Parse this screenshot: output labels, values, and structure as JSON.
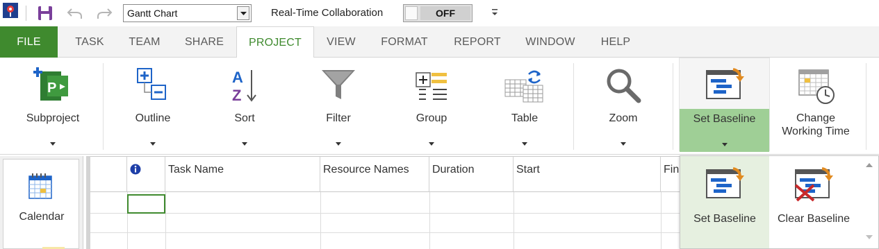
{
  "qat": {
    "view_select_value": "Gantt Chart",
    "collab_label": "Real-Time Collaboration",
    "collab_state": "OFF",
    "icons": [
      "app-icon",
      "save-icon",
      "undo-icon",
      "redo-icon",
      "customize-qat-icon"
    ]
  },
  "tabs": [
    {
      "label": "FILE"
    },
    {
      "label": "TASK"
    },
    {
      "label": "TEAM"
    },
    {
      "label": "SHARE"
    },
    {
      "label": "PROJECT"
    },
    {
      "label": "VIEW"
    },
    {
      "label": "FORMAT"
    },
    {
      "label": "REPORT"
    },
    {
      "label": "WINDOW"
    },
    {
      "label": "HELP"
    }
  ],
  "active_tab": "PROJECT",
  "ribbon": {
    "subproject": "Subproject",
    "outline": "Outline",
    "sort": "Sort",
    "filter": "Filter",
    "group": "Group",
    "table": "Table",
    "zoom": "Zoom",
    "set_baseline": "Set Baseline",
    "change_working_time_line1": "Change",
    "change_working_time_line2": "Working Time"
  },
  "left_pane": {
    "calendar": "Calendar"
  },
  "grid": {
    "columns": [
      "",
      "Task Name",
      "Resource Names",
      "Duration",
      "Start",
      "Fin"
    ]
  },
  "baseline_menu": {
    "set_baseline": "Set Baseline",
    "clear_baseline": "Clear Baseline"
  },
  "colors": {
    "accent_green": "#3f8a2e",
    "highlight_green": "#9fcf96",
    "ribbon_bg": "#ffffff",
    "tab_bg": "#f3f3f3"
  }
}
